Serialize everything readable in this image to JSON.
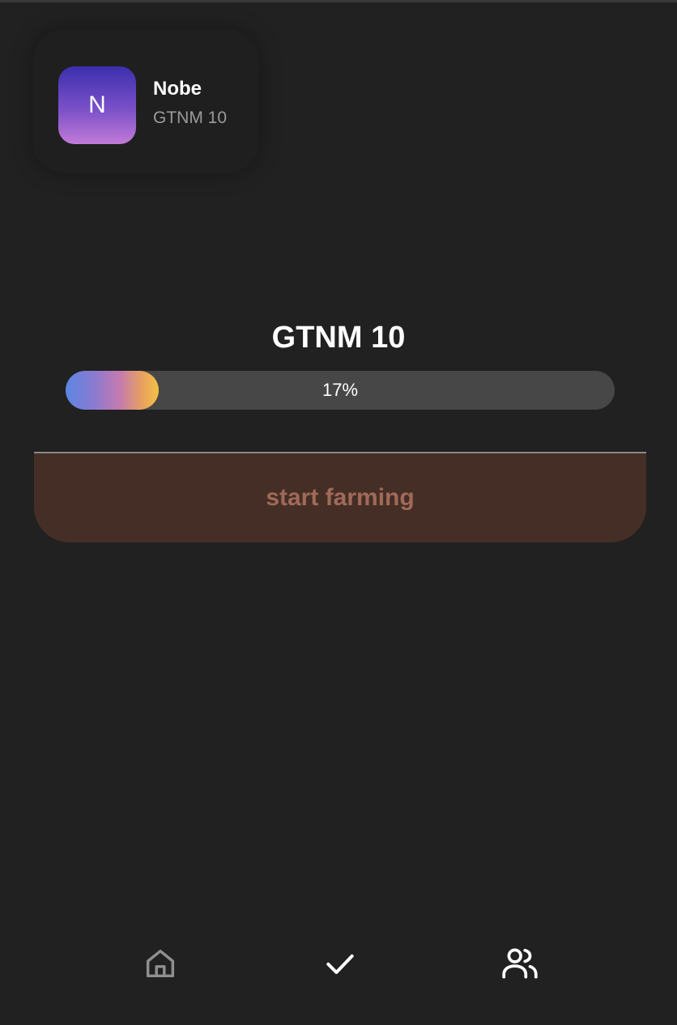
{
  "profile": {
    "avatar_letter": "N",
    "name": "Nobe",
    "subtitle": "GTNM 10"
  },
  "level": {
    "title": "GTNM 10",
    "progress_percent": 17,
    "progress_label": "17%"
  },
  "actions": {
    "farm_label": "start farming"
  },
  "nav": {
    "items": [
      {
        "icon": "home-icon",
        "active": false
      },
      {
        "icon": "check-icon",
        "active": true
      },
      {
        "icon": "users-icon",
        "active": true
      }
    ]
  },
  "colors": {
    "background": "#212121",
    "button_bg": "#442e26",
    "button_text": "#a06a58",
    "progress_track": "#474747",
    "nav_inactive": "#8f8f8f",
    "nav_active": "#ffffff"
  }
}
